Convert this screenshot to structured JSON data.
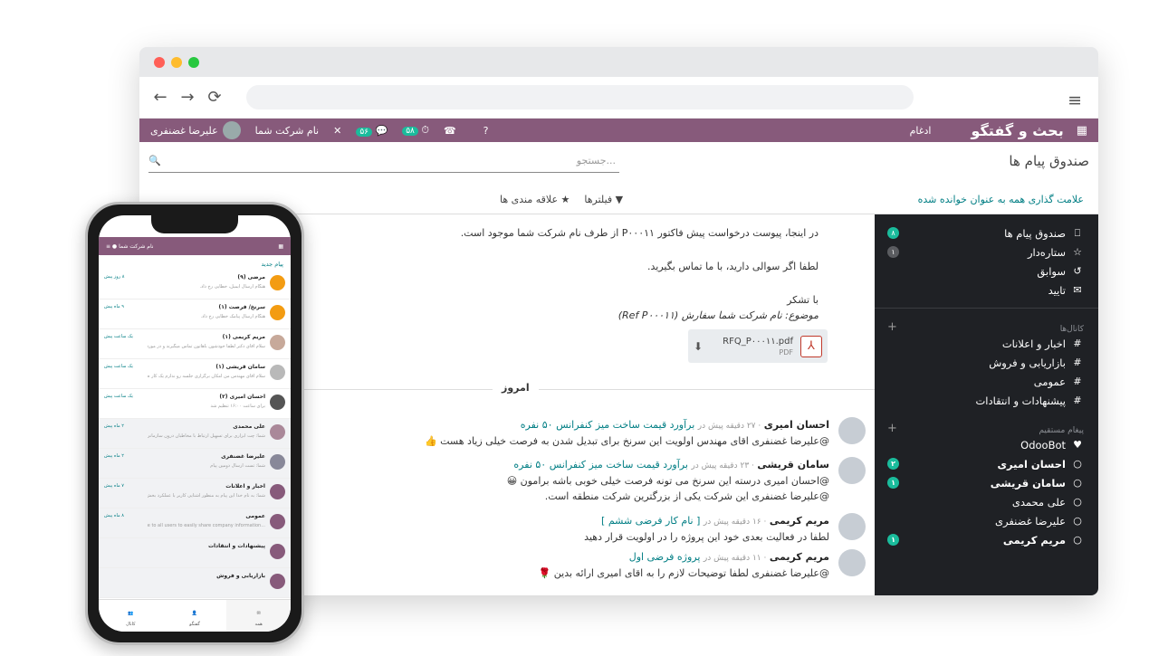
{
  "browser": {
    "nav_back": "←",
    "nav_fwd": "→",
    "reload": "⟳",
    "menu": "≡"
  },
  "topbar": {
    "app_title": "بحث و گفتگو",
    "menu_merge": "ادغام",
    "user_name": "علیرضا غضنفری",
    "company_name": "نام شرکت شما",
    "badge_chat": "۵۶",
    "badge_activity": "۵۸"
  },
  "control": {
    "breadcrumb": "صندوق پیام ها",
    "search_placeholder": "جستجو...",
    "mark_all_read": "علامت گذاری همه به عنوان خوانده شده",
    "filters": "فیلترها",
    "favorites": "علاقه مندی ها"
  },
  "sidebar": {
    "mailboxes": [
      {
        "label": "صندوق پیام ها",
        "count": "۸",
        "green": true
      },
      {
        "label": "ستاره‌دار",
        "count": "۱",
        "green": false
      },
      {
        "label": "سوابق",
        "count": "",
        "green": false
      },
      {
        "label": "تایید",
        "count": "",
        "green": false
      }
    ],
    "channels_title": "کانال‌ها",
    "channels": [
      "اخبار و اعلانات",
      "بازاریابی و فروش",
      "عمومی",
      "پیشنهادات و انتقادات"
    ],
    "direct_title": "پیغام مستقیم",
    "directs": [
      {
        "label": "OdooBot",
        "count": ""
      },
      {
        "label": "احسان امیری",
        "count": "۲"
      },
      {
        "label": "سامان قریشی",
        "count": "۱"
      },
      {
        "label": "علی محمدی",
        "count": ""
      },
      {
        "label": "علیرضا غضنفری",
        "count": ""
      },
      {
        "label": "مریم کریمی",
        "count": "۱"
      }
    ]
  },
  "letter": {
    "line1": "در اینجا، پیوست درخواست پیش فاکتور P۰۰۰۱۱ از طرف نام شرکت شما موجود است.",
    "line2": "لطفا اگر سوالی دارید، با ما تماس بگیرید.",
    "line3": "با تشکر",
    "line4": "موضوع: نام شرکت شما سفارش (Ref P۰۰۰۱۱)",
    "attachment_name": "RFQ_P۰۰۰۱۱.pdf",
    "attachment_ext": "PDF"
  },
  "today_label": "امروز",
  "messages": [
    {
      "author": "احسان امیری",
      "meta": "· ۲۷ دقیقه پیش در",
      "record": "برآورد قیمت ساخت میز کنفرانس ۵۰ نفره",
      "lines": [
        "@علیرضا غضنفری اقای مهندس اولویت این سرنخ برای تبدیل شدن به فرصت خیلی زیاد هست 👍"
      ]
    },
    {
      "author": "سامان قریشی",
      "meta": "· ۲۳ دقیقه پیش در",
      "record": "برآورد قیمت ساخت میز کنفرانس ۵۰ نفره",
      "lines": [
        "@احسان امیری درسته این سرنخ می تونه فرصت خیلی خوبی باشه برامون 😀",
        "@علیرضا غضنفری این شرکت یکی از بزرگترین شرکت منطقه است."
      ]
    },
    {
      "author": "مریم کریمی",
      "meta": "· ۱۶ دقیقه پیش در",
      "record": "[ نام کار فرضی ششم ]",
      "lines": [
        "لطفا در فعالیت بعدی خود این پروژه را در اولویت قرار دهید"
      ]
    },
    {
      "author": "مریم کریمی",
      "meta": "· ۱۱ دقیقه پیش در",
      "record": "پروژه فرضی اول",
      "lines": [
        "@علیرضا غضنفری لطفا توضیحات لازم را به اقای امیری ارائه بدین 🌹"
      ]
    }
  ],
  "phone": {
    "company": "نام شرکت شما",
    "new_label": "پیام جدید",
    "items": [
      {
        "name": "مرضی (۹)",
        "sub": "هنگام ارسال ایمیل، خطایی رخ داد.",
        "time": "۸ روز پیش",
        "gray": false,
        "color": "#f39c12"
      },
      {
        "name": "سرنخ/ فرصت (۱)",
        "sub": "هنگام ارسال پیامک خطایی رخ داد.",
        "time": "۹ ماه پیش",
        "gray": false,
        "color": "#f39c12"
      },
      {
        "name": "مریم کریمی (۱)",
        "sub": "سلام اقای دکتر لطفا خودشون باهاتون تماس میگیرند و در مورد پ...",
        "time": "یک ساعت پیش",
        "gray": false,
        "color": "#c7a99a"
      },
      {
        "name": "سامان قریشی (۱)",
        "sub": "سلام اقای مهندس من امکان برگزاری جلسه رو ندارم یک کار ضرور...",
        "time": "یک ساعت پیش",
        "gray": false,
        "color": "#b9b9b9"
      },
      {
        "name": "احسان امیری (۲)",
        "sub": "برای ساعت ۱۶:۰۰ تنظیم شد",
        "time": "یک ساعت پیش",
        "gray": false,
        "color": "#555"
      },
      {
        "name": "علی محمدی",
        "sub": "شما: چت ابزاری برای تسهیل ارتباط با مخاطبان درون سازمانی و بی...",
        "time": "۲ ماه پیش",
        "gray": true,
        "color": "#a89"
      },
      {
        "name": "علیرضا غضنفری",
        "sub": "شما: تست ارسال دومین پیام",
        "time": "۲ ماه پیش",
        "gray": true,
        "color": "#889"
      },
      {
        "name": "اخبار و اعلانات",
        "sub": "شما: به نام خدا این پیام به منظور آشنایی کاربر با عملکرد بخش کانا...",
        "time": "۷ ماه پیش",
        "gray": true,
        "color": "#875a7b"
      },
      {
        "name": "عمومی",
        "sub": "...e accessible to all users to easily share company information",
        "time": "۸ ماه پیش",
        "gray": true,
        "color": "#875a7b"
      },
      {
        "name": "پیشنهادات و انتقادات",
        "sub": "",
        "time": "",
        "gray": true,
        "color": "#875a7b"
      },
      {
        "name": "بازاریابی و فروش",
        "sub": "",
        "time": "",
        "gray": true,
        "color": "#875a7b"
      }
    ],
    "tabs": [
      "همه",
      "گفتگو",
      "کانال"
    ]
  }
}
